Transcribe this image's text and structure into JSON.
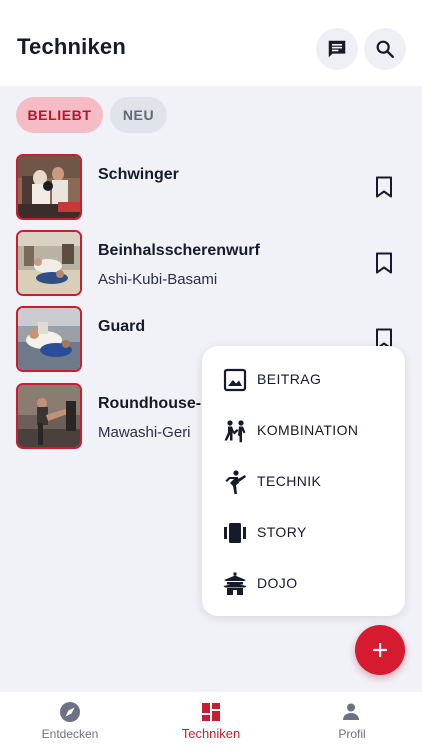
{
  "header": {
    "title": "Techniken",
    "icons": [
      "chat-icon",
      "search-icon"
    ]
  },
  "filters": {
    "chips": [
      {
        "label": "BELIEBT",
        "active": true
      },
      {
        "label": "NEU",
        "active": false
      }
    ]
  },
  "techniques": [
    {
      "title": "Schwinger",
      "subtitle": ""
    },
    {
      "title": "Beinhalsscherenwurf",
      "subtitle": "Ashi-Kubi-Basami"
    },
    {
      "title": "Guard",
      "subtitle": ""
    },
    {
      "title": "Roundhouse-",
      "subtitle": "Mawashi-Geri"
    }
  ],
  "create_menu": {
    "items": [
      {
        "label": "BEITRAG",
        "icon": "image-icon"
      },
      {
        "label": "KOMBINATION",
        "icon": "sparring-icon"
      },
      {
        "label": "TECHNIK",
        "icon": "kick-icon"
      },
      {
        "label": "STORY",
        "icon": "story-icon"
      },
      {
        "label": "DOJO",
        "icon": "dojo-icon"
      }
    ]
  },
  "fab": {
    "icon": "plus-icon"
  },
  "bottom_nav": {
    "items": [
      {
        "label": "Entdecken",
        "icon": "compass-icon",
        "active": false
      },
      {
        "label": "Techniken",
        "icon": "dashboard-icon",
        "active": true
      },
      {
        "label": "Profil",
        "icon": "person-icon",
        "active": false
      }
    ]
  },
  "colors": {
    "accent": "#d61a2f",
    "chip_active_bg": "#f6bcc6",
    "chip_active_text": "#b3172c",
    "background": "#f1f2f8"
  }
}
